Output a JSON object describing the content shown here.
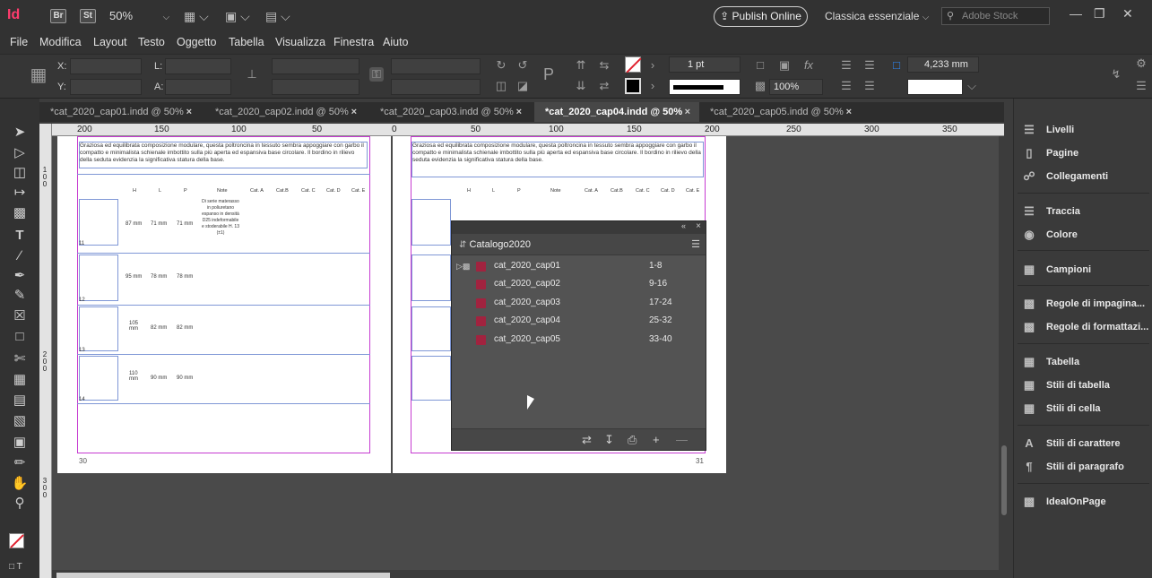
{
  "appbar": {
    "logo": "Id",
    "bridge": "Br",
    "stock_app": "St",
    "zoom": "50%",
    "publish_label": "Publish Online",
    "workspace": "Classica essenziale",
    "search_placeholder": "Adobe Stock",
    "window_controls": [
      "minimize-icon",
      "maximize-icon",
      "close-icon"
    ]
  },
  "menu": {
    "items": [
      "File",
      "Modifica",
      "Layout",
      "Testo",
      "Oggetto",
      "Tabella",
      "Visualizza",
      "Finestra",
      "Aiuto"
    ]
  },
  "control": {
    "x_label": "X:",
    "y_label": "Y:",
    "l_label": "L:",
    "a_label": "A:",
    "stroke_weight": "1 pt",
    "percent": "100%",
    "gutter": "4,233 mm"
  },
  "tabs": [
    {
      "label": "*cat_2020_cap01.indd @ 50%",
      "active": false
    },
    {
      "label": "*cat_2020_cap02.indd @ 50%",
      "active": false
    },
    {
      "label": "*cat_2020_cap03.indd @ 50%",
      "active": false
    },
    {
      "label": "*cat_2020_cap04.indd @ 50%",
      "active": true
    },
    {
      "label": "*cat_2020_cap05.indd @ 50%",
      "active": false
    }
  ],
  "ruler": {
    "labels": [
      "200",
      "150",
      "100",
      "50",
      "0",
      "50",
      "100",
      "150",
      "200",
      "250",
      "300",
      "350"
    ]
  },
  "vruler": {
    "labels": [
      "1 0 0",
      "2 0 0",
      "3 0 0"
    ]
  },
  "document": {
    "intro_text": "Graziosa ed equilibrata composizione modulare, questa poltroncina in tessuto sembra appoggiare con garbo il compatto e minimalista schienale imbottito sulla più aperta ed espansiva base circolare. Il bordino in rilievo della seduta evidenzia la significativa statura della base.",
    "table_headers": [
      "H",
      "L",
      "P",
      "Note",
      "Cat. A",
      "Cat.B",
      "Cat. C",
      "Cat. D",
      "Cat. E"
    ],
    "note_text": "Di serie materasso in poliuretano espanso in densità D25 indeformabile e stoderabile H. 13 (±1)",
    "rows": [
      {
        "num": "11",
        "h": "87 mm",
        "l": "71 mm",
        "p": "71 mm"
      },
      {
        "num": "12",
        "h": "95 mm",
        "l": "78 mm",
        "p": "78 mm"
      },
      {
        "num": "13",
        "h": "105 mm",
        "l": "82 mm",
        "p": "82 mm"
      },
      {
        "num": "14",
        "h": "110 mm",
        "l": "90 mm",
        "p": "90 mm"
      }
    ],
    "left_page_num": "30",
    "right_page_num": "31"
  },
  "book_panel": {
    "title": "Catalogo2020",
    "items": [
      {
        "name": "cat_2020_cap01",
        "pages": "1-8"
      },
      {
        "name": "cat_2020_cap02",
        "pages": "9-16"
      },
      {
        "name": "cat_2020_cap03",
        "pages": "17-24"
      },
      {
        "name": "cat_2020_cap04",
        "pages": "25-32"
      },
      {
        "name": "cat_2020_cap05",
        "pages": "33-40"
      }
    ]
  },
  "right_panel": {
    "groups": [
      [
        "Livelli",
        "Pagine",
        "Collegamenti"
      ],
      [
        "Traccia",
        "Colore"
      ],
      [
        "Campioni"
      ],
      [
        "Regole di impagina...",
        "Regole di formattazi..."
      ],
      [
        "Tabella",
        "Stili di tabella",
        "Stili di cella"
      ],
      [
        "Stili di carattere",
        "Stili di paragrafo"
      ],
      [
        "IdealOnPage"
      ]
    ]
  },
  "colors": {
    "accent": "#ff3b6d",
    "frame": "#c63bd1",
    "guide": "#7f97d6"
  }
}
